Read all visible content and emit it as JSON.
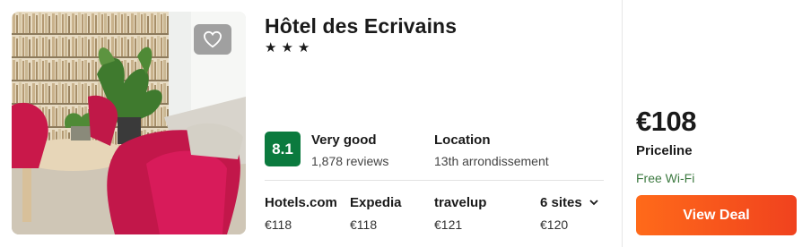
{
  "hotel": {
    "name": "Hôtel des Ecrivains",
    "stars": "★★★",
    "score": "8.1",
    "rating_label": "Very good",
    "reviews": "1,878 reviews",
    "location_label": "Location",
    "location_value": "13th arrondissement"
  },
  "offers": [
    {
      "site": "Hotels.com",
      "price": "€118"
    },
    {
      "site": "Expedia",
      "price": "€118"
    },
    {
      "site": "travelup",
      "price": "€121"
    }
  ],
  "more_sites": {
    "label": "6 sites",
    "price": "€120"
  },
  "deal": {
    "price": "€108",
    "provider": "Priceline",
    "amenity": "Free Wi-Fi",
    "button_label": "View Deal"
  },
  "colors": {
    "score_badge": "#0b7a3e",
    "button_start": "#ff6a1a",
    "button_end": "#f0421e",
    "amenity_text": "#3d7a41"
  },
  "icons": {
    "favorite": "heart-outline-icon",
    "expand": "chevron-down-icon"
  }
}
